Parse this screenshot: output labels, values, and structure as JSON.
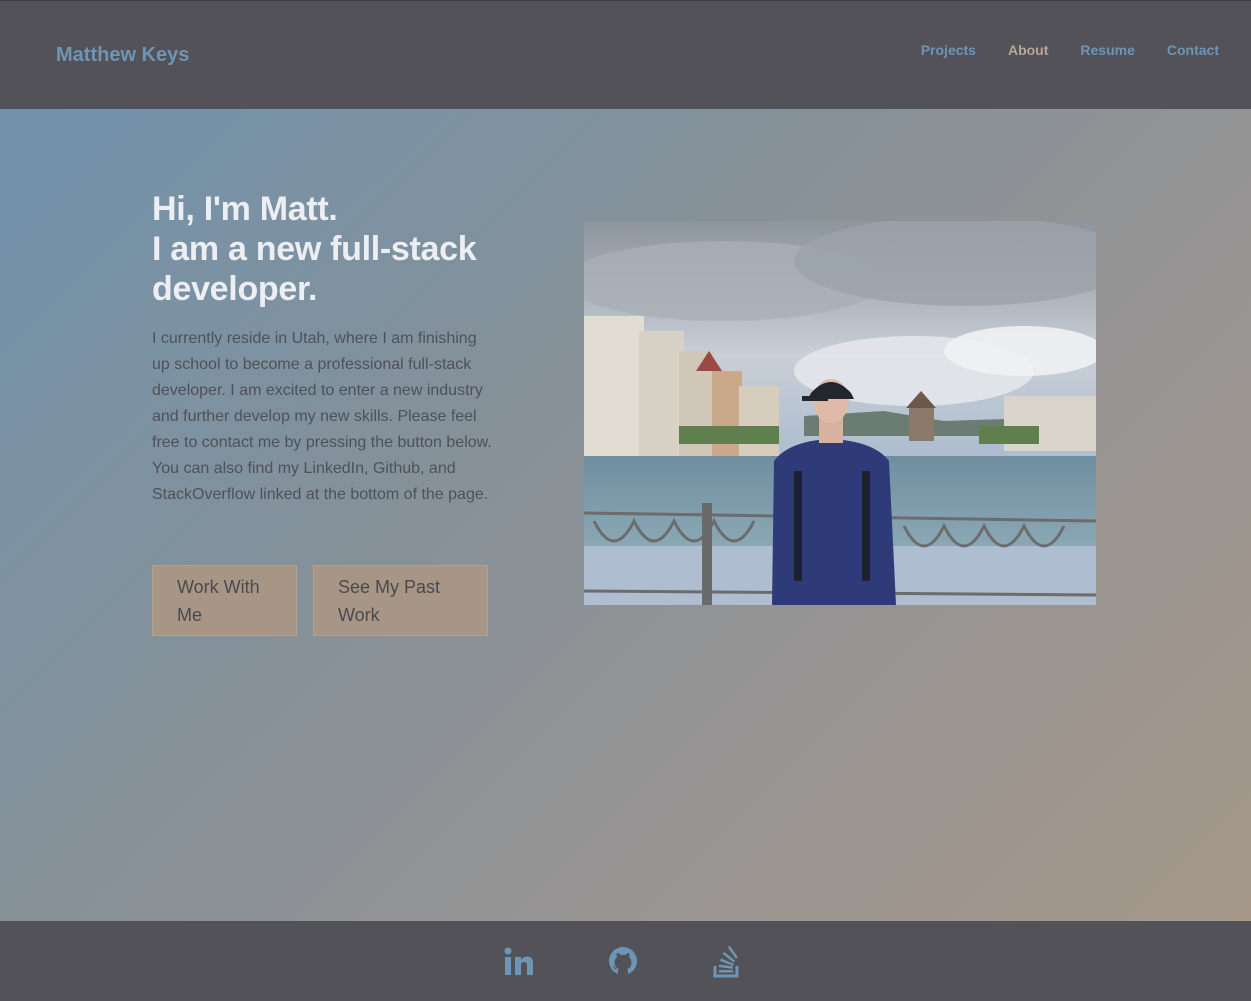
{
  "header": {
    "brand": "Matthew Keys",
    "nav": [
      {
        "label": "Projects"
      },
      {
        "label": "About"
      },
      {
        "label": "Resume"
      },
      {
        "label": "Contact"
      }
    ]
  },
  "hero": {
    "headline_line1": "Hi, I'm Matt.",
    "headline_line2": "I am a new full-stack developer.",
    "bio": "I currently reside in Utah, where I am finishing up school to become a professional full-stack developer. I am excited to enter a new industry and further develop my new skills. Please feel free to contact me by pressing the button below. You can also find my LinkedIn, Github, and StackOverflow linked at the bottom of the page.",
    "buttons": [
      {
        "label": "Work With Me"
      },
      {
        "label": "See My Past Work"
      }
    ],
    "photo_icon": "profile-photo"
  },
  "footer": {
    "links": [
      {
        "icon": "linkedin-icon"
      },
      {
        "icon": "github-icon"
      },
      {
        "icon": "stackoverflow-icon"
      }
    ]
  },
  "colors": {
    "header_bg": "#525258",
    "brand": "#6d95b6",
    "nav_active": "#b9a694",
    "button_bg": "#a79686",
    "gradient_start": "#7192ad",
    "gradient_end": "#a59889"
  }
}
